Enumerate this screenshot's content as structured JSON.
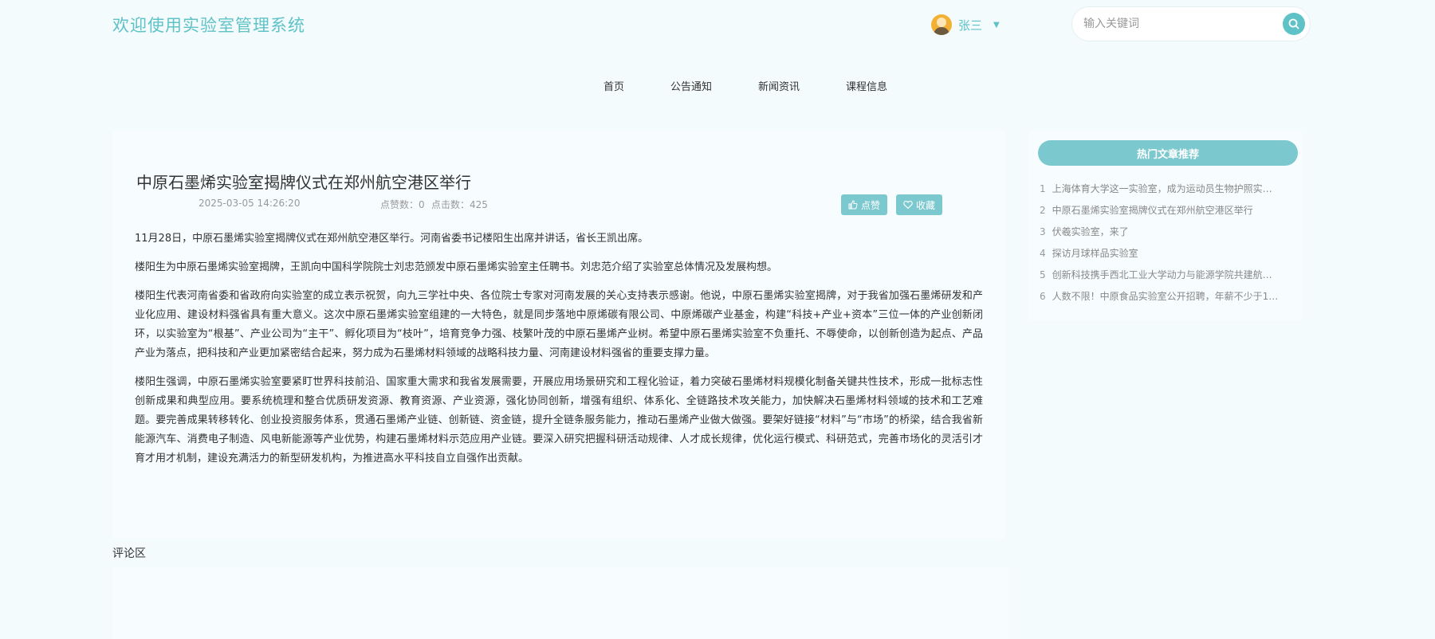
{
  "header": {
    "site_title": "欢迎使用实验室管理系统",
    "user_name": "张三",
    "search_placeholder": "输入关键词"
  },
  "nav": {
    "items": [
      "首页",
      "公告通知",
      "新闻资讯",
      "课程信息"
    ]
  },
  "article": {
    "title": "中原石墨烯实验室揭牌仪式在郑州航空港区举行",
    "datetime": "2025-03-05 14:26:20",
    "likes_label": "点赞数：0",
    "clicks_label": "点击数：425",
    "like_button": "点赞",
    "favorite_button": "收藏",
    "paragraphs": [
      "11月28日，中原石墨烯实验室揭牌仪式在郑州航空港区举行。河南省委书记楼阳生出席并讲话，省长王凯出席。",
      "楼阳生为中原石墨烯实验室揭牌，王凯向中国科学院院士刘忠范颁发中原石墨烯实验室主任聘书。刘忠范介绍了实验室总体情况及发展构想。",
      "楼阳生代表河南省委和省政府向实验室的成立表示祝贺，向九三学社中央、各位院士专家对河南发展的关心支持表示感谢。他说，中原石墨烯实验室揭牌，对于我省加强石墨烯研发和产业化应用、建设材料强省具有重大意义。这次中原石墨烯实验室组建的一大特色，就是同步落地中原烯碳有限公司、中原烯碳产业基金，构建“科技+产业+资本”三位一体的产业创新闭环，以实验室为“根基”、产业公司为“主干”、孵化项目为“枝叶”，培育竞争力强、枝繁叶茂的中原石墨烯产业树。希望中原石墨烯实验室不负重托、不辱使命，以创新创造为起点、产品产业为落点，把科技和产业更加紧密结合起来，努力成为石墨烯材料领域的战略科技力量、河南建设材料强省的重要支撑力量。",
      "楼阳生强调，中原石墨烯实验室要紧盯世界科技前沿、国家重大需求和我省发展需要，开展应用场景研究和工程化验证，着力突破石墨烯材料规模化制备关键共性技术，形成一批标志性创新成果和典型应用。要系统梳理和整合优质研发资源、教育资源、产业资源，强化协同创新，增强有组织、体系化、全链路技术攻关能力，加快解决石墨烯材料领域的技术和工艺难题。要完善成果转移转化、创业投资服务体系，贯通石墨烯产业链、创新链、资金链，提升全链条服务能力，推动石墨烯产业做大做强。要架好链接“材料”与“市场”的桥梁，结合我省新能源汽车、消费电子制造、风电新能源等产业优势，构建石墨烯材料示范应用产业链。要深入研究把握科研活动规律、人才成长规律，优化运行模式、科研范式，完善市场化的灵活引才育才用才机制，建设充满活力的新型研发机构，为推进高水平科技自立自强作出贡献。"
    ]
  },
  "comments": {
    "label": "评论区"
  },
  "sidebar": {
    "title": "热门文章推荐",
    "items": [
      {
        "num": "1",
        "text": "上海体育大学这一实验室，成为运动员生物护照实…"
      },
      {
        "num": "2",
        "text": "中原石墨烯实验室揭牌仪式在郑州航空港区举行"
      },
      {
        "num": "3",
        "text": "伏羲实验室，来了"
      },
      {
        "num": "4",
        "text": "探访月球样品实验室"
      },
      {
        "num": "5",
        "text": "创新科技携手西北工业大学动力与能源学院共建航…"
      },
      {
        "num": "6",
        "text": "人数不限！中原食品实验室公开招聘，年薪不少于1…"
      }
    ]
  },
  "colors": {
    "accent": "#5fc2c6",
    "button": "#7cc8cf",
    "background": "#f3fbfd"
  },
  "icons": [
    "avatar-icon",
    "chevron-down-icon",
    "search-icon",
    "thumbs-up-icon",
    "heart-icon"
  ]
}
